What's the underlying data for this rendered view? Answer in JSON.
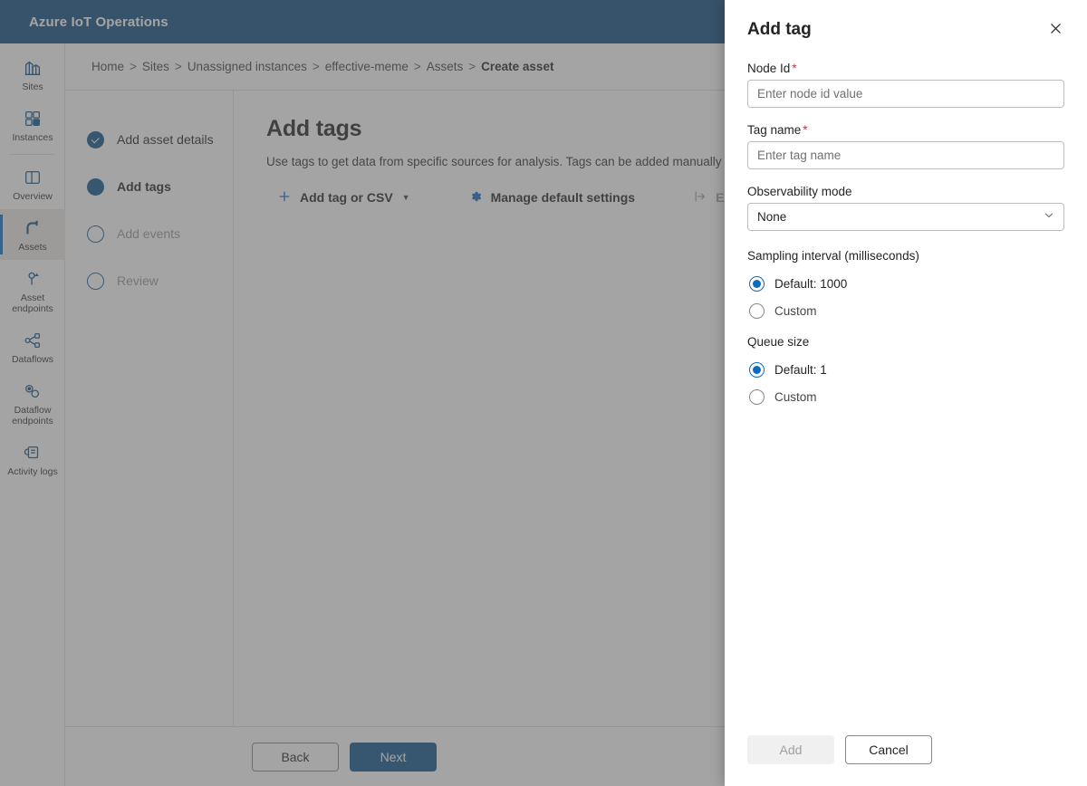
{
  "header": {
    "brand": "Azure IoT Operations",
    "brand_bg": "#0f4c81"
  },
  "sidebar": {
    "items": [
      {
        "label": "Sites",
        "icon": "sites-icon",
        "selected": false
      },
      {
        "label": "Instances",
        "icon": "instances-icon",
        "selected": false
      },
      {
        "label": "Overview",
        "icon": "overview-icon",
        "selected": false
      },
      {
        "label": "Assets",
        "icon": "assets-icon",
        "selected": true
      },
      {
        "label": "Asset endpoints",
        "icon": "asset-endpoints-icon",
        "selected": false
      },
      {
        "label": "Dataflows",
        "icon": "dataflows-icon",
        "selected": false
      },
      {
        "label": "Dataflow endpoints",
        "icon": "dataflow-endpoints-icon",
        "selected": false
      },
      {
        "label": "Activity logs",
        "icon": "activity-logs-icon",
        "selected": false
      }
    ]
  },
  "breadcrumb": {
    "separator": ">",
    "items": [
      {
        "label": "Home",
        "current": false
      },
      {
        "label": "Sites",
        "current": false
      },
      {
        "label": "Unassigned instances",
        "current": false
      },
      {
        "label": "effective-meme",
        "current": false
      },
      {
        "label": "Assets",
        "current": false
      },
      {
        "label": "Create asset",
        "current": true
      }
    ]
  },
  "wizard": {
    "steps": [
      {
        "label": "Add asset details",
        "state": "done"
      },
      {
        "label": "Add tags",
        "state": "active"
      },
      {
        "label": "Add events",
        "state": "todo"
      },
      {
        "label": "Review",
        "state": "todo"
      }
    ],
    "back_label": "Back",
    "next_label": "Next"
  },
  "main": {
    "title": "Add tags",
    "description": "Use tags to get data from specific sources for analysis. Tags can be added manually",
    "toolbar": {
      "add_tag_label": "Add tag or CSV",
      "add_tag_icon": "plus-icon",
      "add_tag_chevron": "chevron-down-icon",
      "manage_label": "Manage default settings",
      "manage_icon": "gear-icon",
      "export_label": "Export all",
      "export_icon": "export-icon",
      "export_disabled": true
    }
  },
  "panel": {
    "title": "Add tag",
    "close_icon": "close-icon",
    "node_id": {
      "label": "Node Id",
      "required_marker": "*",
      "value": "",
      "placeholder": "Enter node id value"
    },
    "tag_name": {
      "label": "Tag name",
      "required_marker": "*",
      "value": "",
      "placeholder": "Enter tag name"
    },
    "observability_mode": {
      "label": "Observability mode",
      "selected": "None",
      "chevron_icon": "chevron-down-icon"
    },
    "sampling_interval": {
      "label": "Sampling interval (milliseconds)",
      "options": [
        {
          "label": "Default: 1000",
          "checked": true
        },
        {
          "label": "Custom",
          "checked": false
        }
      ]
    },
    "queue_size": {
      "label": "Queue size",
      "options": [
        {
          "label": "Default: 1",
          "checked": true
        },
        {
          "label": "Custom",
          "checked": false
        }
      ]
    },
    "add_label": "Add",
    "add_disabled": true,
    "cancel_label": "Cancel"
  },
  "colors": {
    "brand_blue": "#0f4c81",
    "accent_blue": "#0f6cbd",
    "primary_button": "#0f548c",
    "required_red": "#c4314b"
  }
}
